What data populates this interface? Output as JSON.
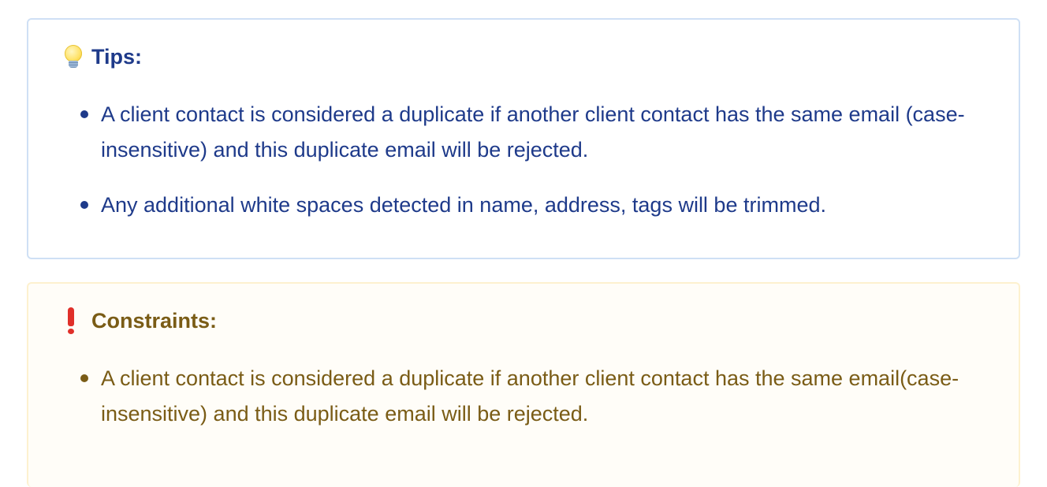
{
  "tips": {
    "icon": "lightbulb-icon",
    "title": "Tips:",
    "color": "#1e3a8a",
    "items": [
      "A client contact is considered a duplicate if another client contact has the same email (case-insensitive) and this duplicate email will be rejected.",
      "Any additional white spaces detected in name, address, tags will be trimmed."
    ]
  },
  "constraints": {
    "icon": "exclamation-icon",
    "title": "Constraints:",
    "color": "#7a5c16",
    "items": [
      "A client contact is considered a duplicate if another client contact has the same email(case-insensitive) and this duplicate email will be rejected."
    ]
  }
}
